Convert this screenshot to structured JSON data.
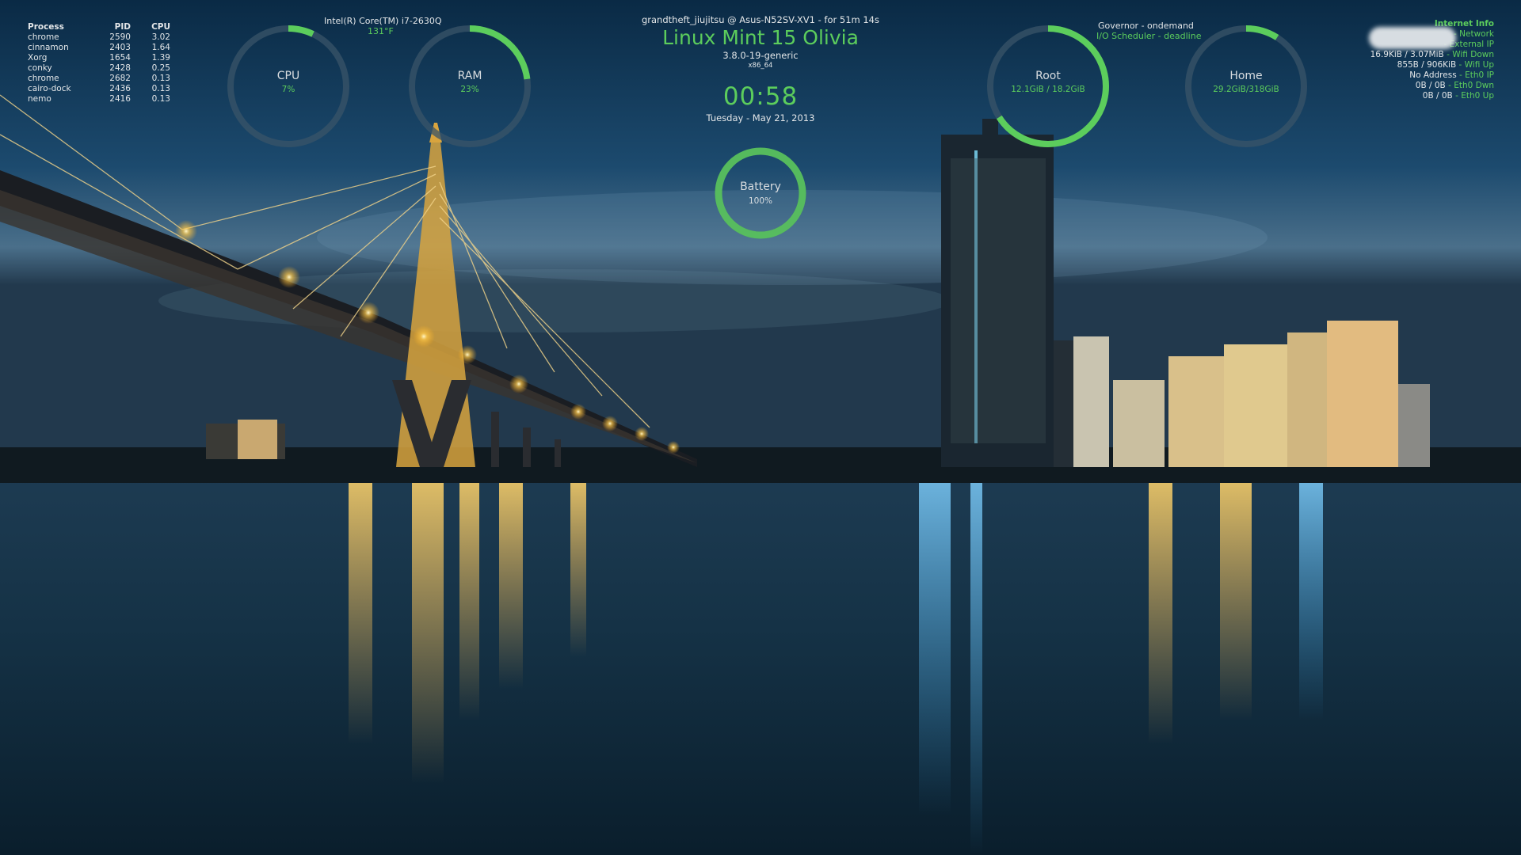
{
  "processes": {
    "headers": {
      "process": "Process",
      "pid": "PID",
      "cpu": "CPU"
    },
    "rows": [
      {
        "name": "chrome",
        "pid": "2590",
        "cpu": "3.02"
      },
      {
        "name": "cinnamon",
        "pid": "2403",
        "cpu": "1.64"
      },
      {
        "name": "Xorg",
        "pid": "1654",
        "cpu": "1.39"
      },
      {
        "name": "conky",
        "pid": "2428",
        "cpu": "0.25"
      },
      {
        "name": "chrome",
        "pid": "2682",
        "cpu": "0.13"
      },
      {
        "name": "cairo-dock",
        "pid": "2436",
        "cpu": "0.13"
      },
      {
        "name": "nemo",
        "pid": "2416",
        "cpu": "0.13"
      }
    ]
  },
  "cpu_info": {
    "model": "Intel(R) Core(TM) i7-2630Q",
    "temp": "131°F"
  },
  "gauges": {
    "cpu": {
      "label": "CPU",
      "value": "7%",
      "fraction": 0.07
    },
    "ram": {
      "label": "RAM",
      "value": "23%",
      "fraction": 0.23
    },
    "battery": {
      "label": "Battery",
      "value": "100%",
      "fraction": 1.0
    },
    "root": {
      "label": "Root",
      "value": "12.1GiB / 18.2GiB",
      "fraction": 0.66
    },
    "home": {
      "label": "Home",
      "value": "29.2GiB/318GiB",
      "fraction": 0.09
    }
  },
  "system": {
    "host_line": "grandtheft_jiujitsu @ Asus-N52SV-XV1 - for 51m 14s",
    "distro": "Linux Mint 15 Olivia",
    "kernel": "3.8.0-19-generic",
    "arch": "x86_64",
    "time": "00:58",
    "date": "Tuesday - May 21, 2013"
  },
  "scheduler": {
    "governor": "Governor - ondemand",
    "io": "I/O Scheduler - deadline"
  },
  "internet": {
    "title": "Internet Info",
    "lines": [
      {
        "value": "",
        "key": "- Network"
      },
      {
        "value": "",
        "key": "- External IP"
      },
      {
        "value": "16.9KiB / 3.07MiB",
        "key": "- Wifi Down"
      },
      {
        "value": "855B / 906KiB",
        "key": "- Wifi Up"
      },
      {
        "value": "No Address",
        "key": "- Eth0 IP"
      },
      {
        "value": "0B / 0B",
        "key": "- Eth0 Dwn"
      },
      {
        "value": "0B / 0B",
        "key": "- Eth0 Up"
      }
    ]
  },
  "colors": {
    "accent": "#5ccd5c",
    "track": "#3a5468",
    "text": "#e3e6e8"
  }
}
